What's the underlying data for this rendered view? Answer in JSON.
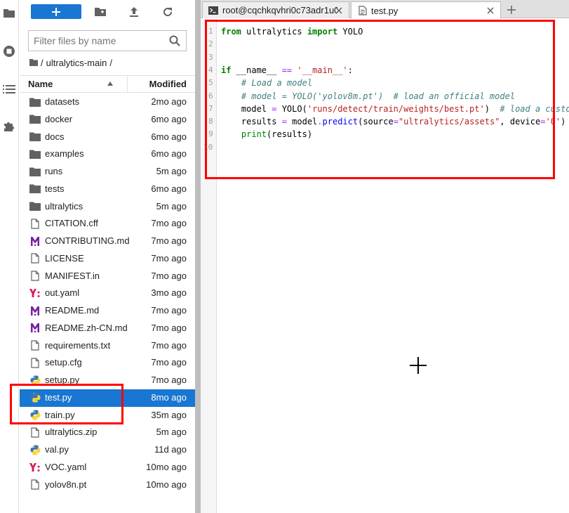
{
  "browser": {
    "filter_placeholder": "Filter files by name",
    "breadcrumb": {
      "sep": "/",
      "folder": "ultralytics-main",
      "trail": "/"
    },
    "header": {
      "name": "Name",
      "modified": "Modified"
    },
    "files": [
      {
        "name": "datasets",
        "modified": "2mo ago",
        "icon": "folder-icon"
      },
      {
        "name": "docker",
        "modified": "6mo ago",
        "icon": "folder-icon"
      },
      {
        "name": "docs",
        "modified": "6mo ago",
        "icon": "folder-icon"
      },
      {
        "name": "examples",
        "modified": "6mo ago",
        "icon": "folder-icon"
      },
      {
        "name": "runs",
        "modified": "5m ago",
        "icon": "folder-icon"
      },
      {
        "name": "tests",
        "modified": "6mo ago",
        "icon": "folder-icon"
      },
      {
        "name": "ultralytics",
        "modified": "5m ago",
        "icon": "folder-icon"
      },
      {
        "name": "CITATION.cff",
        "modified": "7mo ago",
        "icon": "file-icon"
      },
      {
        "name": "CONTRIBUTING.md",
        "modified": "7mo ago",
        "icon": "markdown-icon"
      },
      {
        "name": "LICENSE",
        "modified": "7mo ago",
        "icon": "file-icon"
      },
      {
        "name": "MANIFEST.in",
        "modified": "7mo ago",
        "icon": "file-icon"
      },
      {
        "name": "out.yaml",
        "modified": "3mo ago",
        "icon": "yaml-icon"
      },
      {
        "name": "README.md",
        "modified": "7mo ago",
        "icon": "markdown-icon"
      },
      {
        "name": "README.zh-CN.md",
        "modified": "7mo ago",
        "icon": "markdown-icon"
      },
      {
        "name": "requirements.txt",
        "modified": "7mo ago",
        "icon": "file-icon"
      },
      {
        "name": "setup.cfg",
        "modified": "7mo ago",
        "icon": "file-icon"
      },
      {
        "name": "setup.py",
        "modified": "7mo ago",
        "icon": "python-icon"
      },
      {
        "name": "test.py",
        "modified": "8mo ago",
        "icon": "python-icon",
        "selected": true
      },
      {
        "name": "train.py",
        "modified": "35m ago",
        "icon": "python-icon"
      },
      {
        "name": "ultralytics.zip",
        "modified": "5m ago",
        "icon": "file-icon"
      },
      {
        "name": "val.py",
        "modified": "11d ago",
        "icon": "python-icon"
      },
      {
        "name": "VOC.yaml",
        "modified": "10mo ago",
        "icon": "yaml-icon"
      },
      {
        "name": "yolov8n.pt",
        "modified": "10mo ago",
        "icon": "file-icon"
      }
    ]
  },
  "tabs": [
    {
      "label": "root@cqchkqvhri0c73adr1u0",
      "icon": "terminal-icon"
    },
    {
      "label": "test.py",
      "icon": "text-file-icon",
      "active": true
    }
  ],
  "editor": {
    "line_numbers": [
      "1",
      "2",
      "3",
      "4",
      "5",
      "6",
      "7",
      "8",
      "9",
      "10"
    ],
    "lines": [
      [
        [
          "kw",
          "from"
        ],
        [
          "",
          " ultralytics "
        ],
        [
          "kw",
          "import"
        ],
        [
          "",
          " YOLO"
        ]
      ],
      [],
      [],
      [
        [
          "kw",
          "if"
        ],
        [
          "",
          " __name__ "
        ],
        [
          "op",
          "=="
        ],
        [
          "",
          " "
        ],
        [
          "str",
          "'__main__'"
        ],
        [
          "",
          ":"
        ]
      ],
      [
        [
          "",
          "    "
        ],
        [
          "cm",
          "# Load a model"
        ]
      ],
      [
        [
          "",
          "    "
        ],
        [
          "cm",
          "# model = YOLO('yolov8m.pt')  # load an official model"
        ]
      ],
      [
        [
          "",
          "    model "
        ],
        [
          "op",
          "="
        ],
        [
          "",
          " YOLO("
        ],
        [
          "str",
          "'runs/detect/train/weights/best.pt'"
        ],
        [
          "",
          ")  "
        ],
        [
          "cm",
          "# load a custom model"
        ]
      ],
      [
        [
          "",
          "    results "
        ],
        [
          "op",
          "="
        ],
        [
          "",
          " model"
        ],
        [
          "op",
          "."
        ],
        [
          "fn",
          "predict"
        ],
        [
          "",
          "(source"
        ],
        [
          "op",
          "="
        ],
        [
          "str",
          "\"ultralytics/assets\""
        ],
        [
          "",
          ", device"
        ],
        [
          "op",
          "="
        ],
        [
          "str",
          "'0'"
        ],
        [
          "",
          ")"
        ]
      ],
      [
        [
          "",
          "    "
        ],
        [
          "bi",
          "print"
        ],
        [
          "",
          "(results)"
        ]
      ],
      []
    ]
  },
  "colors": {
    "accent": "#1976d2",
    "highlight_box": "#ff0000"
  }
}
